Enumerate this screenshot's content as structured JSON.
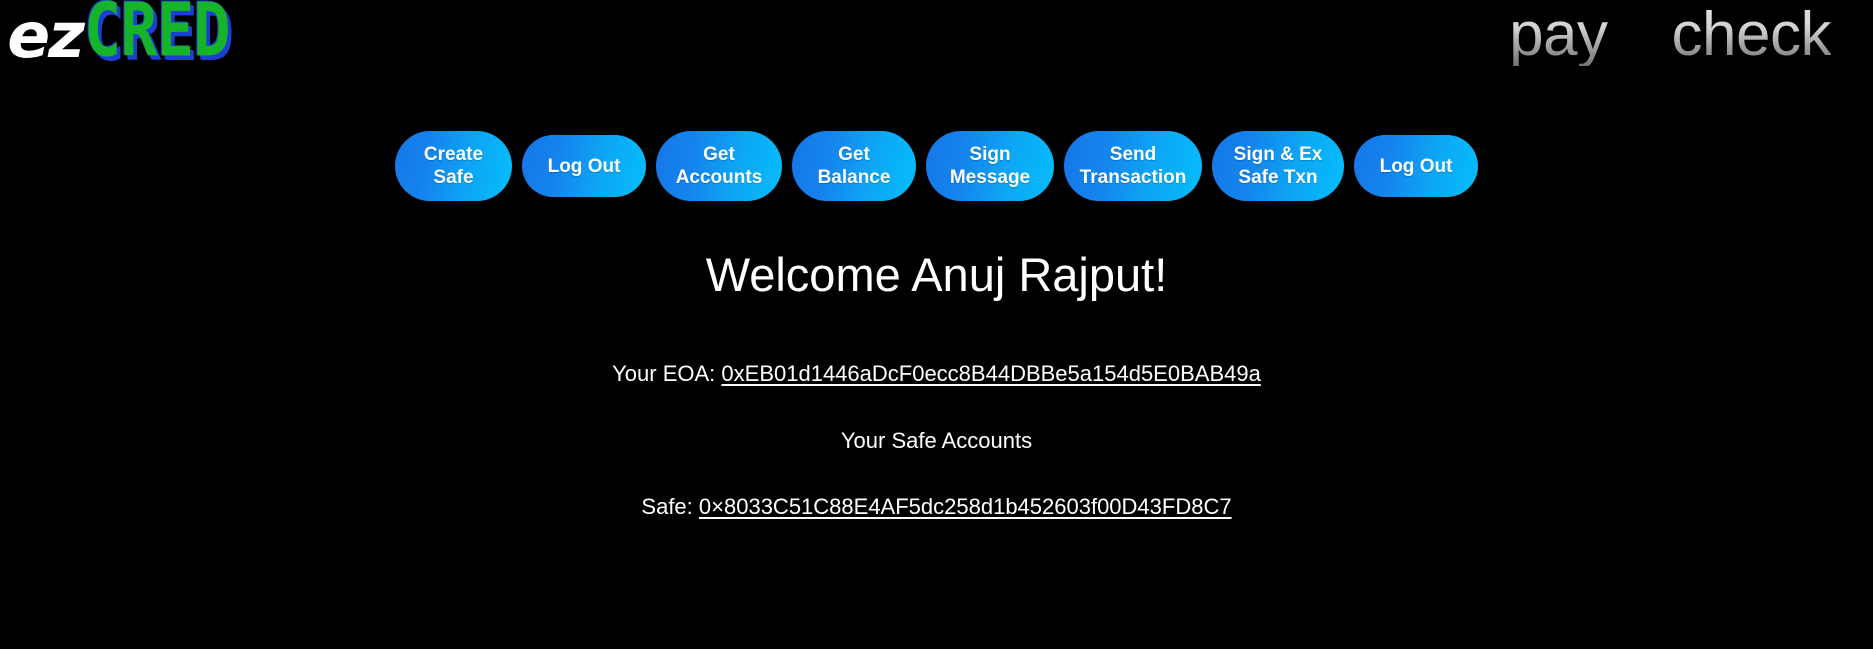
{
  "header": {
    "logo": {
      "part1": "ez",
      "part2": "CRED",
      "green_hex": "#15b42a",
      "shadow_hex": "#1b3fd0"
    },
    "nav": [
      {
        "label": "pay",
        "name": "nav-link-pay"
      },
      {
        "label": "check",
        "name": "nav-link-check"
      }
    ]
  },
  "actions": {
    "buttons": [
      {
        "label": "Create\nSafe",
        "name": "create-safe-button"
      },
      {
        "label": "Log Out",
        "name": "log-out-button"
      },
      {
        "label": "Get\nAccounts",
        "name": "get-accounts-button"
      },
      {
        "label": "Get\nBalance",
        "name": "get-balance-button"
      },
      {
        "label": "Sign\nMessage",
        "name": "sign-message-button"
      },
      {
        "label": "Send\nTransaction",
        "name": "send-transaction-button"
      },
      {
        "label": "Sign & Ex\nSafe Txn",
        "name": "sign-execute-safe-txn-button"
      },
      {
        "label": "Log Out",
        "name": "log-out-button-secondary"
      }
    ],
    "accent_hex": "#1484ee",
    "accent_hex_end": "#05bdfb"
  },
  "main": {
    "welcome": "Welcome Anuj Rajput!",
    "eoa_label": "Your EOA:",
    "eoa_address": "0xEB01d1446aDcF0ecc8B44DBBe5a154d5E0BAB49a",
    "safe_accounts_heading": "Your Safe Accounts",
    "safe_label": "Safe:",
    "safe_address": "0×8033C51C88E4AF5dc258d1b452603f00D43FD8C7"
  }
}
